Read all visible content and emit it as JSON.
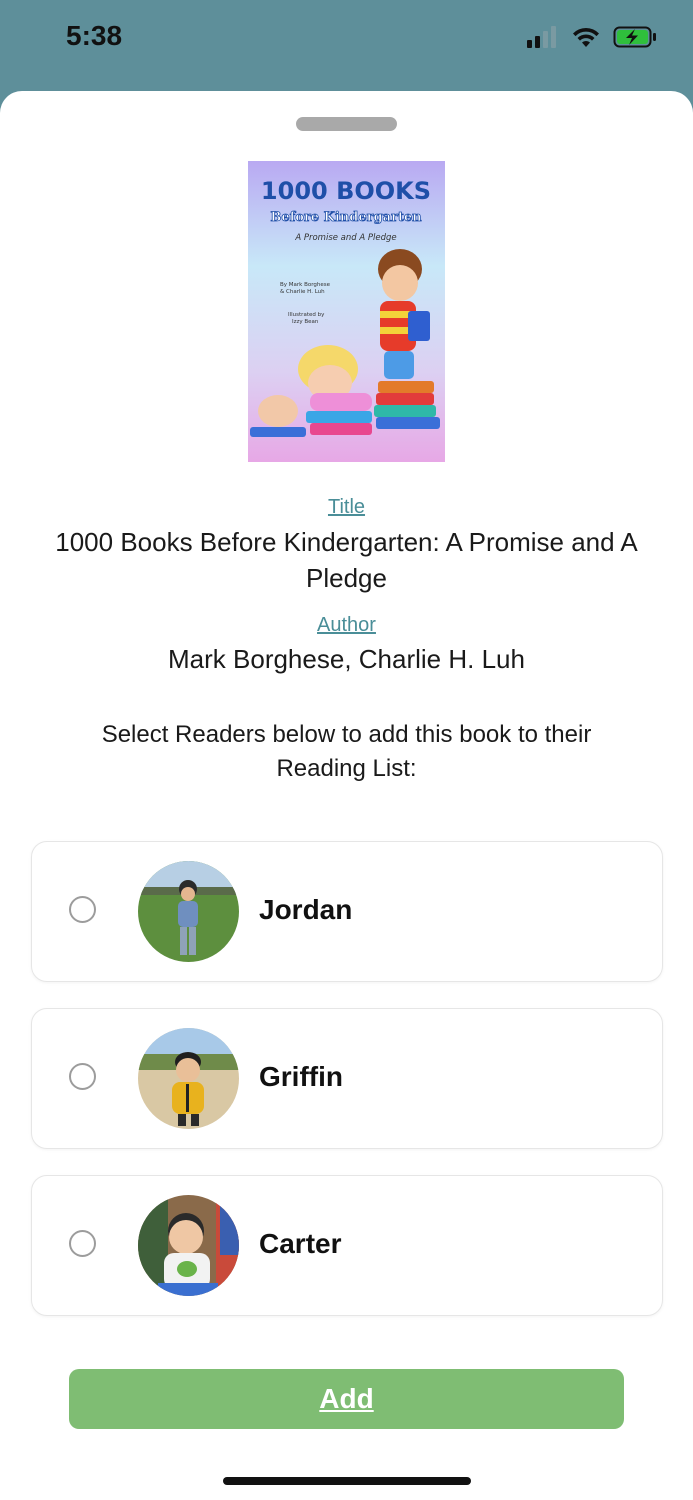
{
  "status_bar": {
    "time": "5:38",
    "battery_color": "#2fbf3c"
  },
  "book": {
    "cover": {
      "heading": "1000 BOOKS",
      "subheading": "Before Kindergarten",
      "tagline": "A Promise and A Pledge",
      "byline_1": "By Mark Borghese",
      "byline_2": "& Charlie H. Luh",
      "illustrator_1": "Illustrated by",
      "illustrator_2": "Izzy Bean"
    },
    "title_label": "Title",
    "title": "1000 Books Before Kindergarten: A Promise and A Pledge",
    "author_label": "Author",
    "author": "Mark Borghese, Charlie H. Luh"
  },
  "instructions": "Select Readers below to add this book to their Reading List:",
  "readers": [
    {
      "name": "Jordan",
      "selected": false
    },
    {
      "name": "Griffin",
      "selected": false
    },
    {
      "name": "Carter",
      "selected": false
    }
  ],
  "add_button": {
    "label": "Add",
    "color": "#7fbd73"
  },
  "colors": {
    "header_bg": "#5e8f9a",
    "link": "#4a8e98"
  }
}
